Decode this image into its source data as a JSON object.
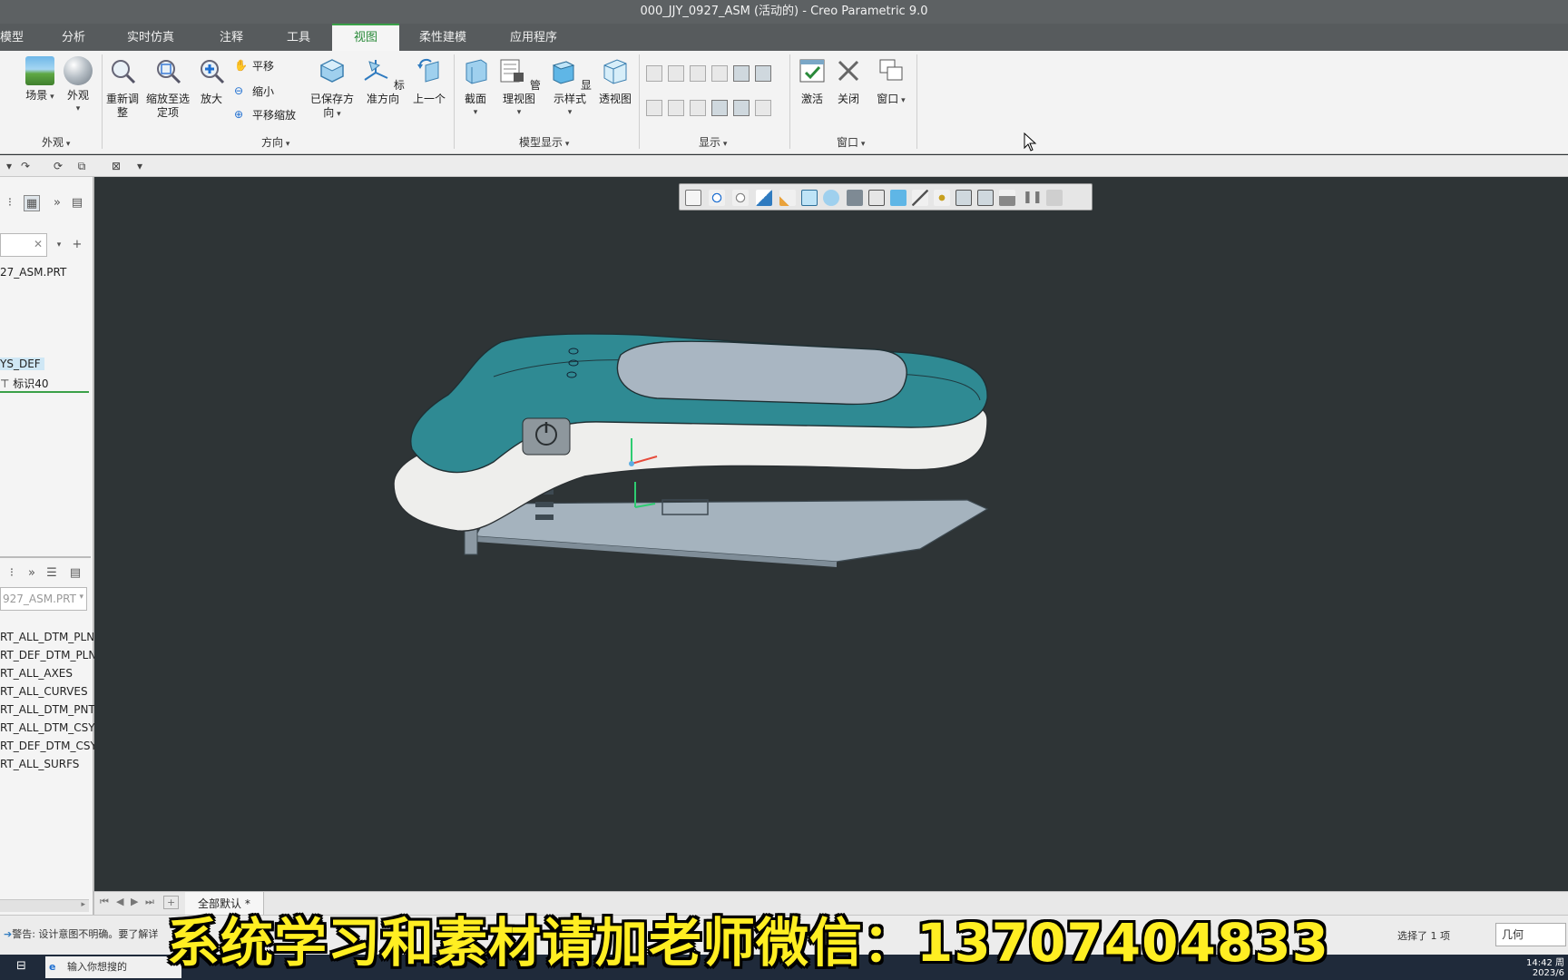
{
  "window": {
    "title": "000_JJY_0927_ASM (活动的) - Creo Parametric 9.0"
  },
  "tabs": [
    {
      "label": "模型",
      "active": false
    },
    {
      "label": "分析",
      "active": false
    },
    {
      "label": "实时仿真",
      "active": false
    },
    {
      "label": "注释",
      "active": false
    },
    {
      "label": "工具",
      "active": false
    },
    {
      "label": "视图",
      "active": true
    },
    {
      "label": "柔性建模",
      "active": false
    },
    {
      "label": "应用程序",
      "active": false
    }
  ],
  "ribbon": {
    "appearance": {
      "scene": "场景",
      "appearance": "外观",
      "group": "外观"
    },
    "orientation": {
      "refit": "重新调\n整",
      "zoom_selected": "缩放至选\n定项",
      "zoom_in": "放大",
      "pan": "平移",
      "zoom_out": "缩小",
      "pan_zoom": "平移缩放",
      "saved_orient": "已保存方\n向",
      "std_orient": "标准方向",
      "previous": "上一个",
      "group": "方向"
    },
    "model_display": {
      "section": "截面",
      "manage_views": "管理视图",
      "display_style": "显示样式",
      "perspective": "透视图",
      "group": "模型显示"
    },
    "show": {
      "group": "显示"
    },
    "window": {
      "activate": "激活",
      "close": "关闭",
      "windows": "窗口",
      "group": "窗口"
    }
  },
  "model_tree": {
    "part_name": "27_ASM.PRT",
    "csys": "YS_DEF",
    "marker": "标识40"
  },
  "layer_tree": {
    "selector": "927_ASM.PRT",
    "layers": [
      "RT_ALL_DTM_PLN",
      "RT_DEF_DTM_PLN",
      "RT_ALL_AXES",
      "RT_ALL_CURVES",
      "RT_ALL_DTM_PNT",
      "RT_ALL_DTM_CSY",
      "RT_DEF_DTM_CSY",
      "RT_ALL_SURFS"
    ]
  },
  "bottom_tabs": {
    "active": "全部默认 *"
  },
  "status": {
    "message": "警告: 设计意图不明确。要了解详",
    "selection": "选择了 1 项",
    "filter": "几何"
  },
  "taskbar": {
    "search": "输入你想搜的",
    "time": "14:42 周",
    "date": "2023/6"
  },
  "overlay": {
    "caption": "系统学习和素材请加老师微信：13707404833"
  },
  "colors": {
    "accent": "#3aa048",
    "model_teal": "#2f8a93",
    "model_white": "#eeeeec",
    "board": "#a5b4bf",
    "viewport": "#2e3436"
  }
}
